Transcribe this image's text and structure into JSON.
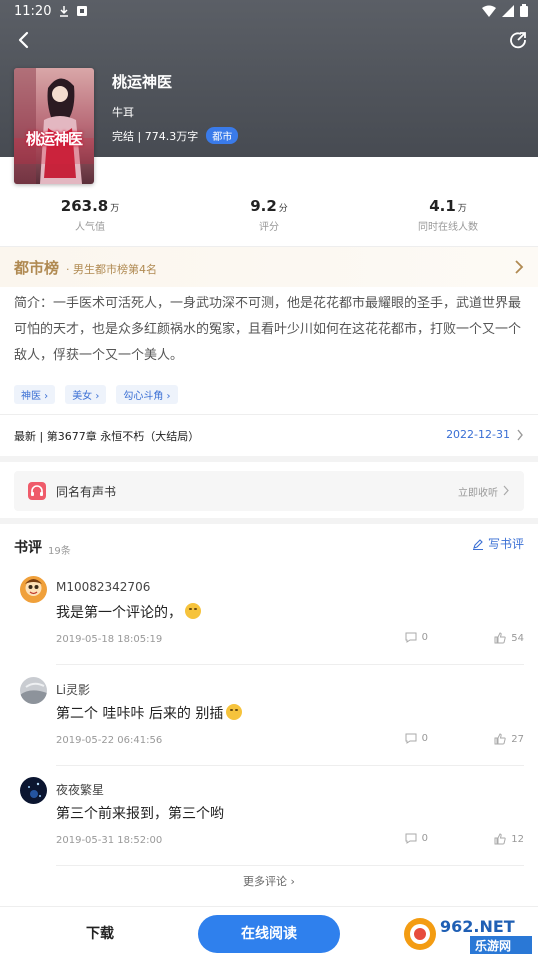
{
  "status_bar": {
    "time": "11:20"
  },
  "book": {
    "title": "桃运神医",
    "author": "牛耳",
    "meta": "完结 | 774.3万字",
    "genre": "都市",
    "cover_text": "桃运神医"
  },
  "stats": [
    {
      "value": "263.8",
      "unit": "万",
      "label": "人气值"
    },
    {
      "value": "9.2",
      "unit": "分",
      "label": "评分"
    },
    {
      "value": "4.1",
      "unit": "万",
      "label": "同时在线人数"
    }
  ],
  "ranking": {
    "title": "都市榜",
    "subtitle": "· 男生都市榜第4名"
  },
  "intro": "简介：一手医术可活死人，一身武功深不可测，他是花花都市最耀眼的圣手，武道世界最可怕的天才，也是众多红颜祸水的冤家，且看叶少川如何在这花花都市，打败一个又一个敌人，俘获一个又一个美人。",
  "tags": [
    "神医",
    "美女",
    "勾心斗角"
  ],
  "latest": {
    "text": "最新 | 第3677章 永恒不朽（大结局）",
    "date": "2022-12-31"
  },
  "audiobook": {
    "label": "同名有声书",
    "action": "立即收听"
  },
  "reviews_section": {
    "title": "书评",
    "count": "19条",
    "write_label": "写书评"
  },
  "reviews": [
    {
      "user": "M10082342706",
      "content": "我是第一个评论的，",
      "time": "2019-05-18 18:05:19",
      "comments": "0",
      "likes": "54"
    },
    {
      "user": "Li灵影",
      "content": "第二个  哇咔咔 后来的  别插",
      "time": "2019-05-22 06:41:56",
      "comments": "0",
      "likes": "27"
    },
    {
      "user": "夜夜繁星",
      "content": "第三个前来报到，第三个哟",
      "time": "2019-05-31 18:52:00",
      "comments": "0",
      "likes": "12"
    }
  ],
  "more_reviews": "更多评论",
  "bottom_bar": {
    "download": "下载",
    "read_online": "在线阅读"
  },
  "watermark": {
    "brand": "962.NET",
    "sub": "乐游网"
  },
  "colors": {
    "accent": "#2f80ed",
    "rank_gold": "#b08a52",
    "header_bg": "#4f535a"
  }
}
